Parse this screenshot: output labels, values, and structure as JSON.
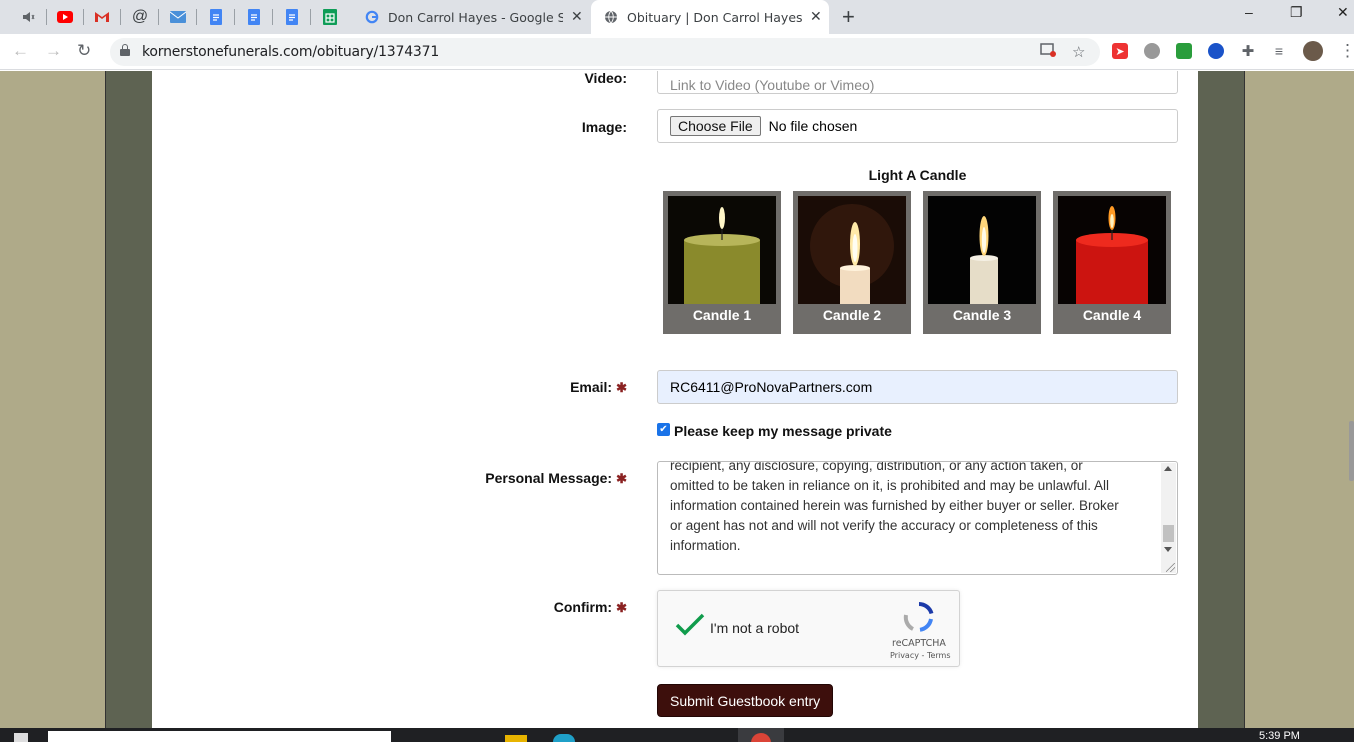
{
  "browser": {
    "pinned_tabs": [
      "mute-tab-icon",
      "youtube-icon",
      "gmail-icon",
      "at-sign-icon",
      "mail-icon",
      "google-docs-icon",
      "google-docs-icon",
      "google-docs-icon",
      "google-sheets-icon"
    ],
    "tabs": [
      {
        "title": "Don Carrol Hayes - Google Searc",
        "favicon": "google-icon",
        "active": false
      },
      {
        "title": "Obituary | Don Carrol Hayes (Pla",
        "favicon": "globe-icon",
        "active": true
      }
    ],
    "new_tab_label": "+",
    "window_controls": {
      "minimize": "–",
      "restore": "❐",
      "close": "✕"
    },
    "url": "kornerstonefunerals.com/obituary/1374371",
    "nav": {
      "back": "←",
      "forward": "→",
      "reload": "↻",
      "menu": "⋮"
    }
  },
  "form": {
    "video": {
      "label": "Video:",
      "placeholder": "Link to Video (Youtube or Vimeo)"
    },
    "image": {
      "label": "Image:",
      "button": "Choose File",
      "status": "No file chosen"
    },
    "candles": {
      "title": "Light A Candle",
      "items": [
        {
          "label": "Candle 1",
          "color": "#9a9a30"
        },
        {
          "label": "Candle 2",
          "color": "#f2dcc0"
        },
        {
          "label": "Candle 3",
          "color": "#e6ddc8"
        },
        {
          "label": "Candle 4",
          "color": "#cc1410"
        }
      ]
    },
    "email": {
      "label": "Email:",
      "required": "✱",
      "value": "RC6411@ProNovaPartners.com"
    },
    "private_checkbox": {
      "label": "Please keep my message private",
      "checked": true
    },
    "message": {
      "label": "Personal Message:",
      "required": "✱",
      "text": "recipient, any disclosure, copying, distribution, or any action taken, or\nomitted to be taken in reliance on it, is prohibited and may be unlawful.  All\ninformation contained herein was furnished by either buyer or seller.  Broker\nor agent has not and will not verify the accuracy or completeness of this\ninformation."
    },
    "confirm": {
      "label": "Confirm:",
      "required": "✱",
      "captcha_text": "I'm not a robot",
      "captcha_brand": "reCAPTCHA",
      "captcha_links": "Privacy - Terms"
    },
    "submit_label": "Submit Guestbook entry"
  },
  "taskbar": {
    "time": "5:39 PM"
  }
}
